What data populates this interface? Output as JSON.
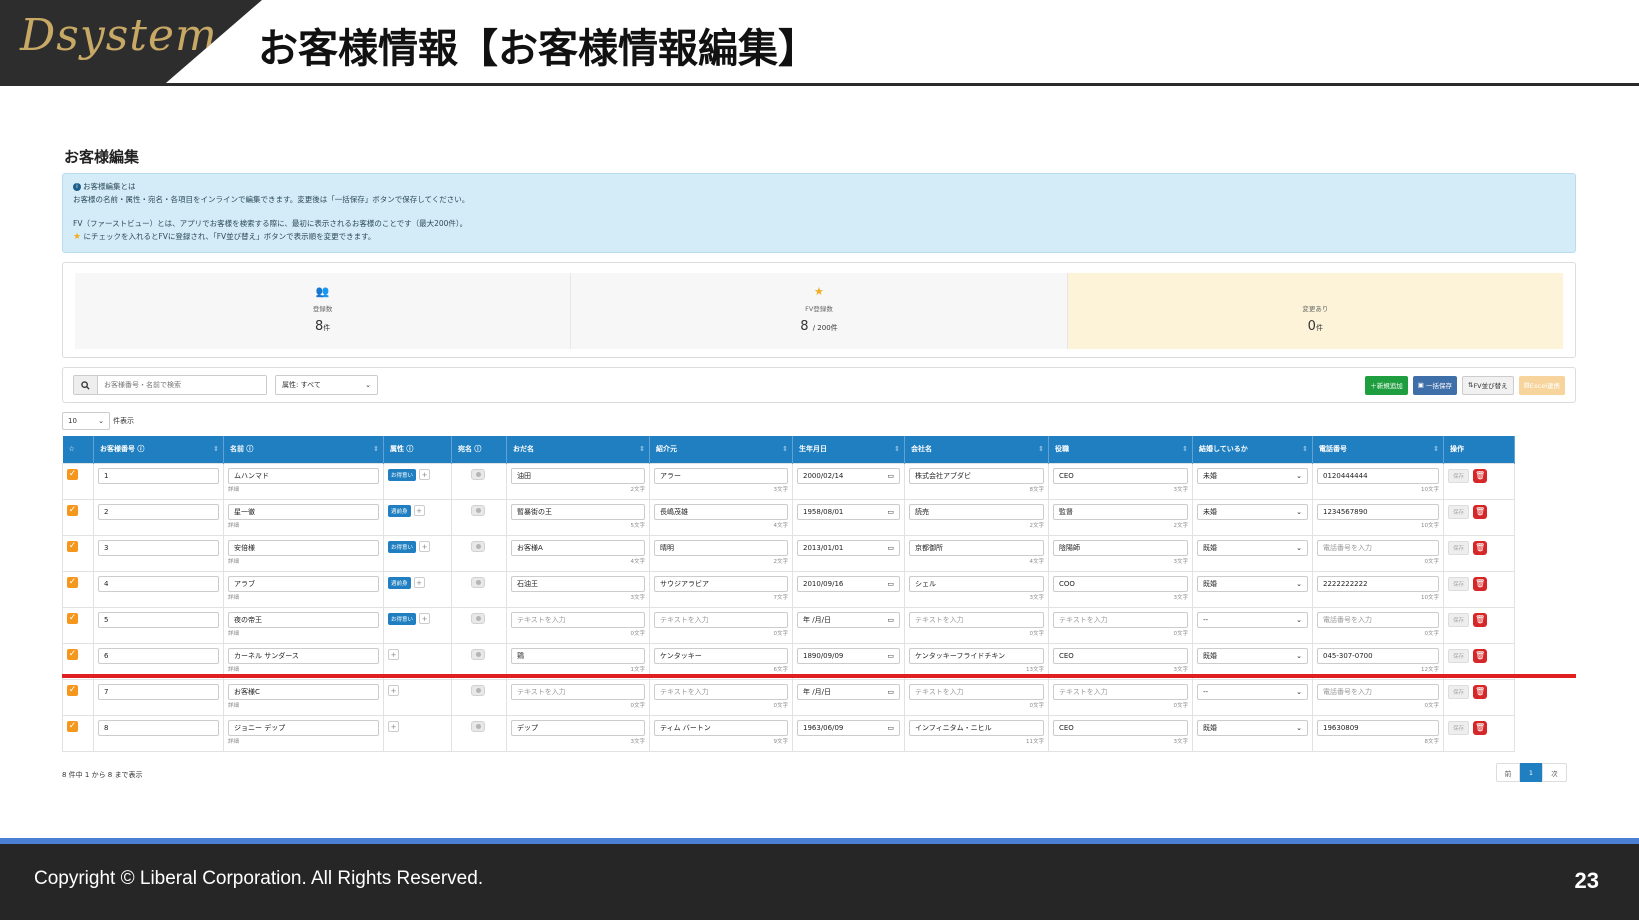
{
  "slide": {
    "logo": "Dsystem",
    "title": "お客様情報【お客様情報編集】",
    "copyright": "Copyright ©  Liberal Corporation. All Rights Reserved.",
    "page_number": "23"
  },
  "app": {
    "heading": "お客様編集",
    "info": {
      "title": "お客様編集とは",
      "line1": "お客様の名前・属性・宛名・各項目をインラインで編集できます。変更後は「一括保存」ボタンで保存してください。",
      "line2": "FV（ファーストビュー）とは、アプリでお客様を検索する際に、最初に表示されるお客様のことです（最大200件）。",
      "line3": "にチェックを入れるとFVに登録され、「FV並び替え」ボタンで表示順を変更できます。"
    },
    "stats": {
      "registered": {
        "label": "登録数",
        "value": "8",
        "unit": "件"
      },
      "fv": {
        "label": "FV登録数",
        "value": "8",
        "unit": "/ 200件"
      },
      "changed": {
        "label": "変更あり",
        "value": "0",
        "unit": "件"
      }
    },
    "toolbar": {
      "search_placeholder": "お客様番号・名前で検索",
      "attr_filter": "属性: すべて",
      "add_button": "＋新規追加",
      "bulk_save_button": "一括保存",
      "fv_sort_button": "FV並び替え",
      "excel_button": "Excel連携"
    },
    "length": {
      "value": "10",
      "suffix": "件表示"
    },
    "columns": [
      "お客様番号",
      "名前",
      "属性",
      "宛名",
      "おだ名",
      "紹介元",
      "生年月日",
      "会社名",
      "役職",
      "結婚しているか",
      "電話番号",
      "操作"
    ],
    "detail_label": "詳細",
    "save_label": "保存",
    "rows": [
      {
        "id": "1",
        "name": "ムハンマド",
        "attr": "お得意い",
        "nick": "油田",
        "nick_count": "2文字",
        "referrer": "アラー",
        "ref_count": "3文字",
        "birthday": "2000/02/14",
        "company": "株式会社アブダビ",
        "company_count": "8文字",
        "position": "CEO",
        "position_count": "3文字",
        "married": "未婚",
        "phone": "0120444444",
        "phone_count": "10文字"
      },
      {
        "id": "2",
        "name": "星一徹",
        "attr": "週前身",
        "nick": "暫暴街の王",
        "nick_count": "5文字",
        "referrer": "長嶋茂雄",
        "ref_count": "4文字",
        "birthday": "1958/08/01",
        "company": "読売",
        "company_count": "2文字",
        "position": "監督",
        "position_count": "2文字",
        "married": "未婚",
        "phone": "1234567890",
        "phone_count": "10文字"
      },
      {
        "id": "3",
        "name": "安倍様",
        "attr": "お得意い",
        "nick": "お客様A",
        "nick_count": "4文字",
        "referrer": "晴明",
        "ref_count": "2文字",
        "birthday": "2013/01/01",
        "company": "京都御所",
        "company_count": "4文字",
        "position": "陰陽師",
        "position_count": "3文字",
        "married": "既婚",
        "phone": "電話番号を入力",
        "phone_count": "0文字"
      },
      {
        "id": "4",
        "name": "アラブ",
        "attr": "週前身",
        "nick": "石油王",
        "nick_count": "3文字",
        "referrer": "サウジアラビア",
        "ref_count": "7文字",
        "birthday": "2010/09/16",
        "company": "シェル",
        "company_count": "3文字",
        "position": "COO",
        "position_count": "3文字",
        "married": "既婚",
        "phone": "2222222222",
        "phone_count": "10文字"
      },
      {
        "id": "5",
        "name": "夜の帝王",
        "attr": "お得意い",
        "nick": "テキストを入力",
        "nick_count": "0文字",
        "referrer": "テキストを入力",
        "ref_count": "0文字",
        "birthday": "年 /月/日",
        "company": "テキストを入力",
        "company_count": "0文字",
        "position": "テキストを入力",
        "position_count": "0文字",
        "married": "--",
        "phone": "電話番号を入力",
        "phone_count": "0文字"
      },
      {
        "id": "6",
        "name": "カーネル サンダース",
        "attr": "",
        "nick": "鶏",
        "nick_count": "1文字",
        "referrer": "ケンタッキー",
        "ref_count": "6文字",
        "birthday": "1890/09/09",
        "company": "ケンタッキーフライドチキン",
        "company_count": "13文字",
        "position": "CEO",
        "position_count": "3文字",
        "married": "既婚",
        "phone": "045-307-0700",
        "phone_count": "12文字"
      },
      {
        "id": "7",
        "name": "お客様C",
        "attr": "",
        "nick": "テキストを入力",
        "nick_count": "0文字",
        "referrer": "テキストを入力",
        "ref_count": "0文字",
        "birthday": "年 /月/日",
        "company": "テキストを入力",
        "company_count": "0文字",
        "position": "テキストを入力",
        "position_count": "0文字",
        "married": "--",
        "phone": "電話番号を入力",
        "phone_count": "0文字"
      },
      {
        "id": "8",
        "name": "ジョニー デップ",
        "attr": "",
        "nick": "デップ",
        "nick_count": "3文字",
        "referrer": "ティム バートン",
        "ref_count": "9文字",
        "birthday": "1963/06/09",
        "company": "インフィニタム・ニヒル",
        "company_count": "11文字",
        "position": "CEO",
        "position_count": "3文字",
        "married": "既婚",
        "phone": "19630809",
        "phone_count": "8文字"
      }
    ],
    "table_info": "8 件中 1 から 8 まで表示",
    "pagination": {
      "prev": "前",
      "current": "1",
      "next": "次"
    },
    "colors": {
      "header": "#1f7fc0",
      "accent_orange": "#f5961d",
      "delete_red": "#d62728",
      "highlight": "#e02020"
    }
  }
}
